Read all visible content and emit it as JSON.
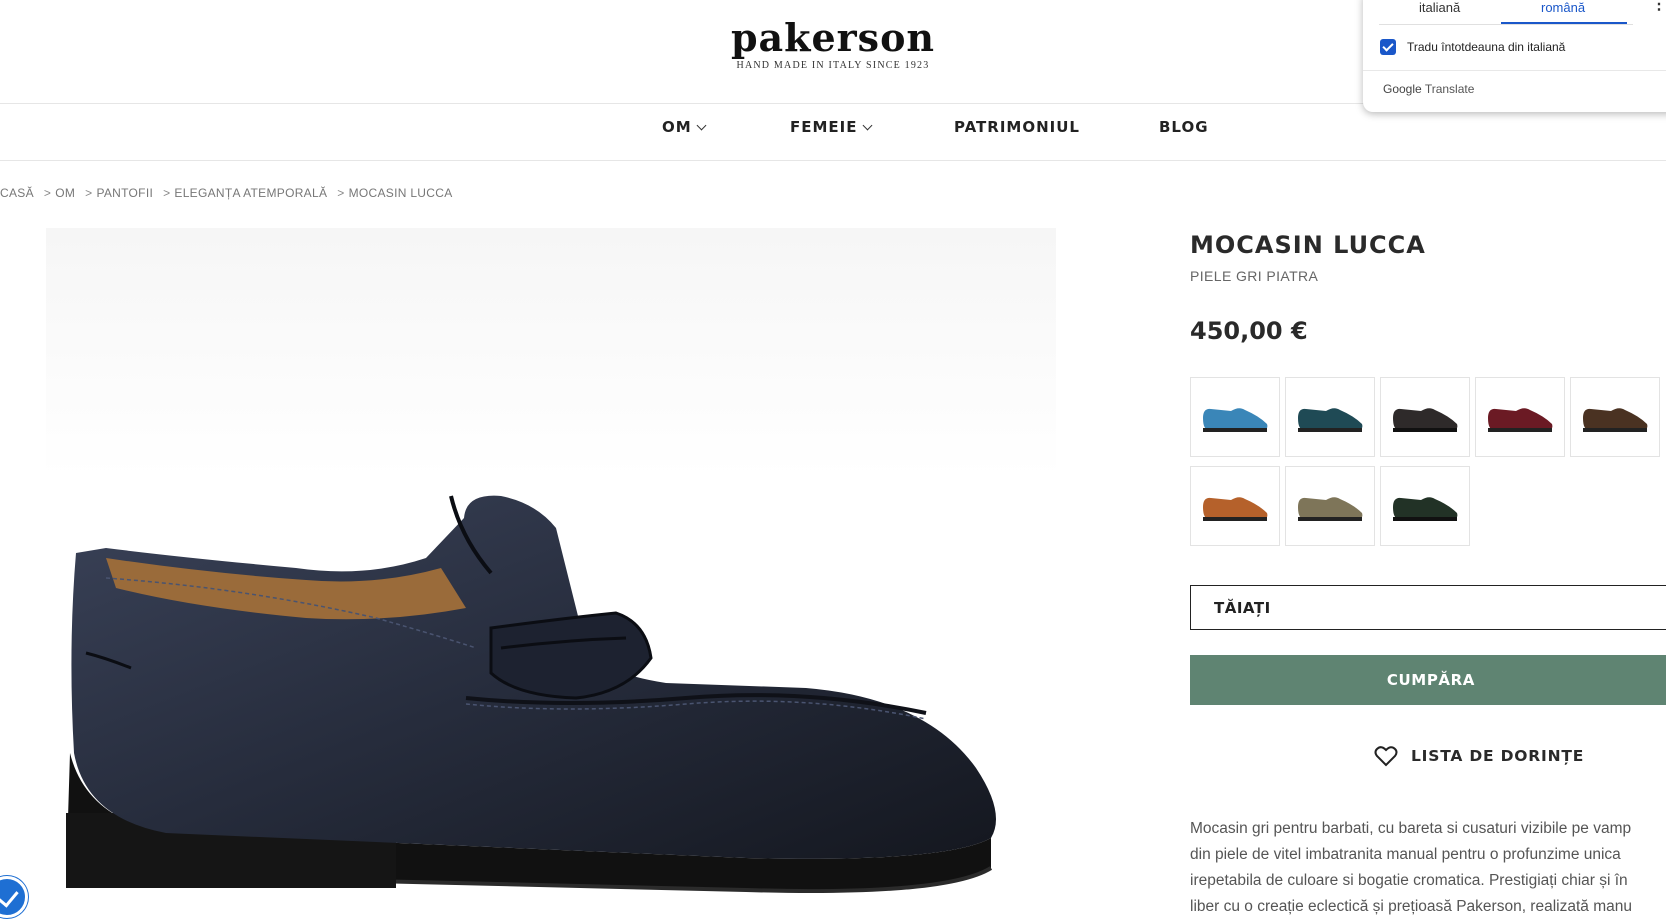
{
  "header": {
    "logo": "pakerson",
    "tagline": "HAND MADE IN ITALY SINCE 1923"
  },
  "nav": {
    "items": [
      {
        "label": "OM",
        "has_dropdown": true
      },
      {
        "label": "FEMEIE",
        "has_dropdown": true
      },
      {
        "label": "PATRIMONIUL",
        "has_dropdown": false
      },
      {
        "label": "BLOG",
        "has_dropdown": false
      }
    ]
  },
  "breadcrumb": [
    "CASĂ",
    "OM",
    "PANTOFII",
    "ELEGANȚA ATEMPORALĂ",
    "MOCASIN LUCCA"
  ],
  "breadcrumb_separator": ">",
  "product": {
    "title": "MOCASIN LUCCA",
    "subtitle": "PIELE GRI PIATRA",
    "price": "450,00 €",
    "main_color": "#2a3040",
    "swatches": [
      {
        "color": "#3a86b8",
        "name": "blue"
      },
      {
        "color": "#1f4a55",
        "name": "teal"
      },
      {
        "color": "#2e2a2a",
        "name": "black-brown"
      },
      {
        "color": "#6b1a24",
        "name": "burgundy"
      },
      {
        "color": "#4a3222",
        "name": "dark-brown"
      },
      {
        "color": "#b5612b",
        "name": "cognac"
      },
      {
        "color": "#7e7559",
        "name": "olive-grey"
      },
      {
        "color": "#223226",
        "name": "dark-green"
      }
    ],
    "size_label": "TĂIAȚI",
    "buy_label": "CUMPĂRA",
    "wishlist_label": "LISTA DE DORINȚE",
    "description_lines": [
      "Mocasin gri pentru barbati, cu bareta si cusaturi vizibile pe vamp",
      "din piele de vitel imbatranita manual pentru o profunzime unica",
      "irepetabila de culoare si bogatie cromatica. Prestigiați chiar și în",
      "liber cu o creație eclectică și prețioasă Pakerson, realizată manu"
    ]
  },
  "translate_popup": {
    "tab_source": "italiană",
    "tab_target": "română",
    "always_translate": "Tradu întotdeauna din italiană",
    "always_checked": true,
    "brand_google": "Google",
    "brand_translate": "Translate"
  },
  "colors": {
    "buy_button": "#5f8472",
    "accent_blue": "#1a57c9"
  }
}
